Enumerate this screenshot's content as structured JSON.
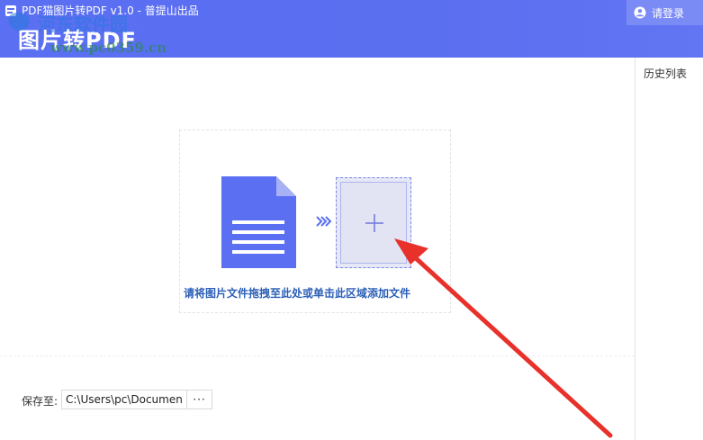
{
  "window": {
    "title": "PDF猫图片转PDF v1.0 - 普提山出品",
    "brand": "图片转PDF",
    "watermark": "河东软件园 www.pc0359.cn"
  },
  "header": {
    "login_label": "请登录"
  },
  "sidebar": {
    "title": "历史列表"
  },
  "drop_zone": {
    "hint": "请将图片文件拖拽至此处或单击此区域添加文件"
  },
  "save": {
    "label": "保存至:",
    "path": "C:\\Users\\pc\\Documents",
    "browse_label": "···"
  },
  "colors": {
    "header": "#5b6ff3",
    "accent": "#5b6ff3",
    "hint_text": "#2b5fb7",
    "annotation": "#e8312a"
  },
  "icons": {
    "app": "app-icon",
    "user": "user-icon",
    "document": "document-icon",
    "arrows": "chevrons-right-icon",
    "add": "plus-icon"
  }
}
